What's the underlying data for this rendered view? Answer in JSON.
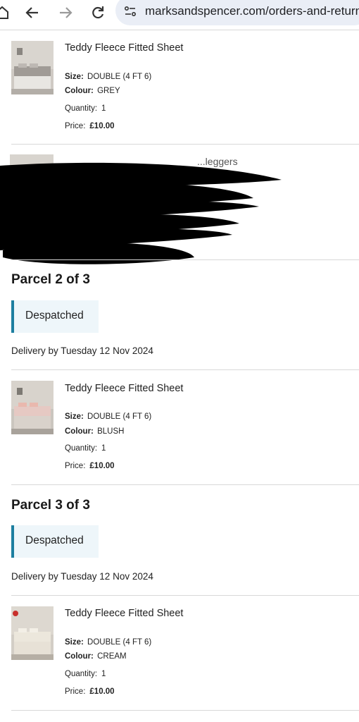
{
  "browser": {
    "url": "marksandspencer.com/orders-and-returns",
    "icons": [
      "home-icon",
      "back-arrow-icon",
      "forward-arrow-icon",
      "reload-icon",
      "site-settings-icon"
    ]
  },
  "labels": {
    "size": "Size:",
    "colour": "Colour:",
    "quantity": "Quantity:",
    "price": "Price:"
  },
  "items": [
    {
      "title": "Teddy Fleece Fitted Sheet",
      "size": "DOUBLE (4 FT 6)",
      "colour": "GREY",
      "quantity": "1",
      "price": "£10.00",
      "image": "bed-grey-thumbnail"
    },
    {
      "title": "Teddy Fleece Fitted Sheet",
      "size": "DOUBLE (4 FT 6)",
      "colour": "BLUSH",
      "quantity": "1",
      "price": "£10.00",
      "image": "bed-blush-thumbnail"
    },
    {
      "title": "Teddy Fleece Fitted Sheet",
      "size": "DOUBLE (4 FT 6)",
      "colour": "CREAM",
      "quantity": "1",
      "price": "£10.00",
      "image": "bed-cream-thumbnail"
    }
  ],
  "redacted_item": {
    "partial_text": "...leggers"
  },
  "parcels": [
    {
      "title": "Parcel 2 of 3",
      "status": "Despatched",
      "delivery": "Delivery by Tuesday 12 Nov 2024"
    },
    {
      "title": "Parcel 3 of 3",
      "status": "Despatched",
      "delivery": "Delivery by Tuesday 12 Nov 2024"
    }
  ],
  "colors": {
    "status_accent": "#1d7fa0",
    "status_bg": "#eef6fa",
    "url_bar": "#eaeef6"
  }
}
